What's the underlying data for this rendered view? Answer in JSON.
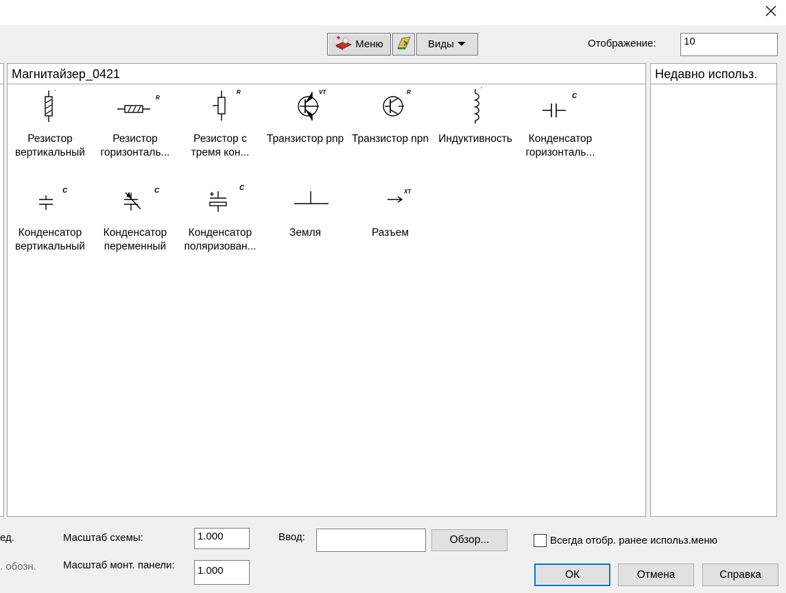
{
  "toolbar": {
    "menu_label": "Меню",
    "views_label": "Виды",
    "display_label": "Отображение:",
    "display_value": "10"
  },
  "main_panel": {
    "title": "Магнитайзер_0421",
    "symbols": [
      {
        "name": "Резистор\nвертикальный",
        "tag": "'"
      },
      {
        "name": "Резистор\nгоризонталь...",
        "tag": "R"
      },
      {
        "name": "Резистор с\nтремя кон...",
        "tag": "R"
      },
      {
        "name": "Транзистор pnp",
        "tag": "VT"
      },
      {
        "name": "Транзистор npn",
        "tag": "R"
      },
      {
        "name": "Индуктивность",
        "tag": "'"
      },
      {
        "name": "Конденсатор\nгоризонталь...",
        "tag": "C"
      },
      {
        "name": "Конденсатор\nвертикальный",
        "tag": "C"
      },
      {
        "name": "Конденсатор\nпеременный",
        "tag": "C"
      },
      {
        "name": "Конденсатор\nполяризован...",
        "tag": "C"
      },
      {
        "name": "Земля",
        "tag": ""
      },
      {
        "name": "Разъем",
        "tag": "XT"
      }
    ]
  },
  "recent_panel": {
    "title": "Недавно использ."
  },
  "bottom": {
    "left_clipped_1": "ед.",
    "left_clipped_2": ". обозн.",
    "scheme_scale_label": "Масштаб схемы:",
    "scheme_scale_value": "1.000",
    "panel_scale_label": "Масштаб монт. панели:",
    "panel_scale_value": "1.000",
    "input_label": "Ввод:",
    "input_value": "",
    "browse_label": "Обзор...",
    "always_show_label": "Всегда отобр. ранее использ.меню",
    "ok_label": "ОК",
    "cancel_label": "Отмена",
    "help_label": "Справка"
  }
}
